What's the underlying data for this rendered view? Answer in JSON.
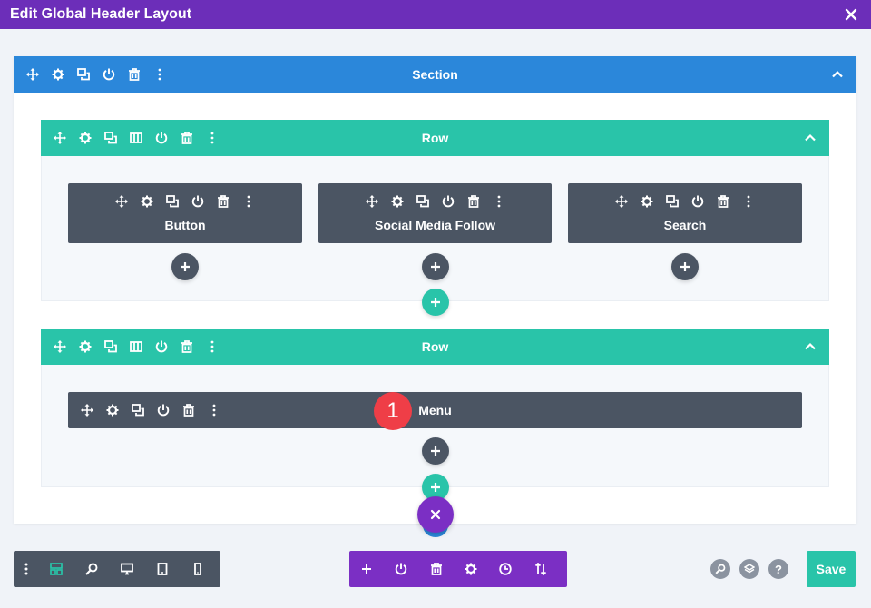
{
  "window": {
    "title": "Edit Global Header Layout"
  },
  "section": {
    "label": "Section"
  },
  "rows": [
    {
      "label": "Row",
      "modules": [
        {
          "label": "Button"
        },
        {
          "label": "Social Media Follow"
        },
        {
          "label": "Search"
        }
      ]
    },
    {
      "label": "Row",
      "modules": [
        {
          "label": "Menu"
        }
      ]
    }
  ],
  "badge": {
    "number": "1"
  },
  "footer": {
    "save_label": "Save",
    "help_label": "?"
  },
  "colors": {
    "titlebar": "#6c2eb9",
    "section": "#2b87da",
    "row": "#29c4a9",
    "module": "#4b5563",
    "builder_toolbar": "#7b2fc4",
    "badge": "#ef3e47",
    "save": "#29c4a9"
  },
  "icons": {
    "bar": [
      "move-icon",
      "gear-icon",
      "duplicate-icon",
      "columns-icon",
      "power-icon",
      "trash-icon",
      "more-icon"
    ],
    "left_toolbar": [
      "more-icon",
      "wireframe-icon",
      "zoom-icon",
      "desktop-icon",
      "tablet-icon",
      "phone-icon"
    ],
    "center_toolbar": [
      "plus-icon",
      "power-icon",
      "trash-icon",
      "gear-icon",
      "history-icon",
      "sort-icon"
    ],
    "right_buttons": [
      "search-icon",
      "layers-icon",
      "help-icon"
    ]
  }
}
